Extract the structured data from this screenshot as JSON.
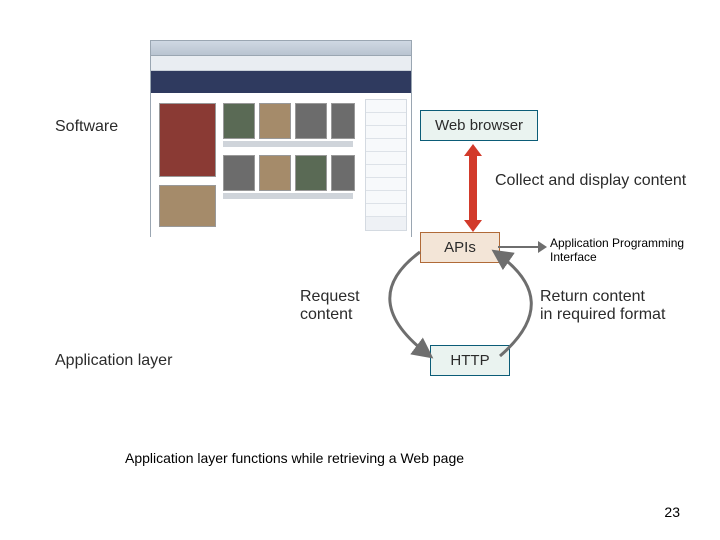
{
  "labels": {
    "software": "Software",
    "application_layer": "Application layer",
    "collect_display": "Collect and display content",
    "request_content_l1": "Request",
    "request_content_l2": "content",
    "return_content_l1": "Return content",
    "return_content_l2": "in required format",
    "api_full_l1": "Application Programming",
    "api_full_l2": "Interface"
  },
  "nodes": {
    "web_browser": "Web browser",
    "apis": "APIs",
    "http": "HTTP"
  },
  "caption": "Application layer functions while retrieving a Web page",
  "page_number": "23"
}
